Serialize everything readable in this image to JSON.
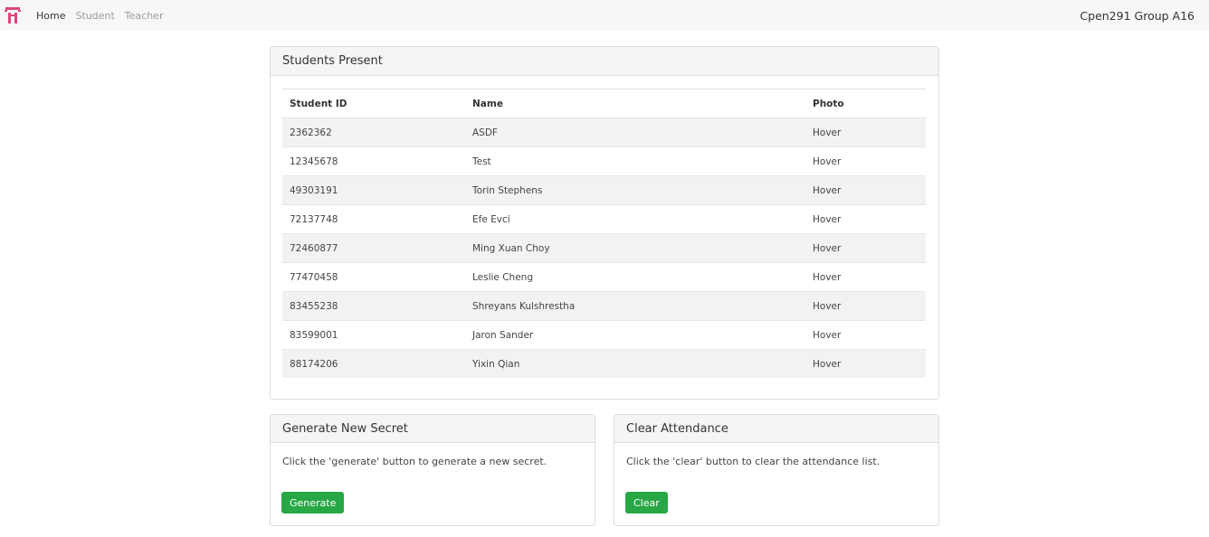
{
  "nav": {
    "links": [
      "Home",
      "Student",
      "Teacher"
    ],
    "brand": "Cpen291 Group A16",
    "logo_color": "#e0457b"
  },
  "students": {
    "title": "Students Present",
    "columns": [
      "Student ID",
      "Name",
      "Photo"
    ],
    "rows": [
      {
        "id": "2362362",
        "name": "ASDF",
        "photo": "Hover"
      },
      {
        "id": "12345678",
        "name": "Test",
        "photo": "Hover"
      },
      {
        "id": "49303191",
        "name": "Torin Stephens",
        "photo": "Hover"
      },
      {
        "id": "72137748",
        "name": "Efe Evci",
        "photo": "Hover"
      },
      {
        "id": "72460877",
        "name": "Ming Xuan Choy",
        "photo": "Hover"
      },
      {
        "id": "77470458",
        "name": "Leslie Cheng",
        "photo": "Hover"
      },
      {
        "id": "83455238",
        "name": "Shreyans Kulshrestha",
        "photo": "Hover"
      },
      {
        "id": "83599001",
        "name": "Jaron Sander",
        "photo": "Hover"
      },
      {
        "id": "88174206",
        "name": "Yixin Qian",
        "photo": "Hover"
      }
    ]
  },
  "generate": {
    "title": "Generate New Secret",
    "text": "Click the 'generate' button to generate a new secret.",
    "button": "Generate"
  },
  "clear": {
    "title": "Clear Attendance",
    "text": "Click the 'clear' button to clear the attendance list.",
    "button": "Clear"
  },
  "colors": {
    "button_green": "#28a745",
    "navbar_bg": "#f7f7f7"
  }
}
